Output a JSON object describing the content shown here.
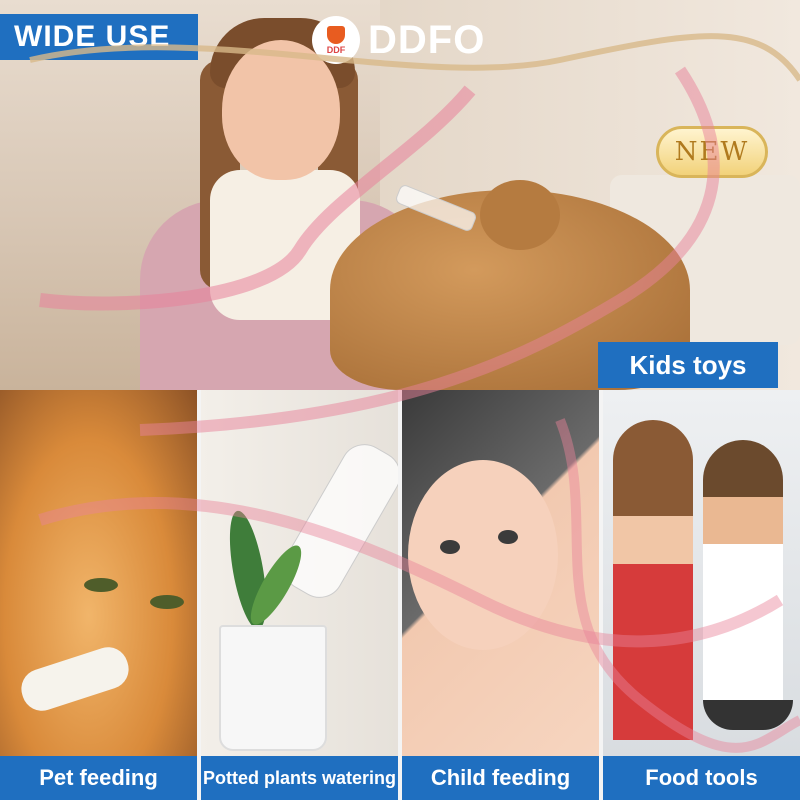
{
  "top_label": "WIDE USE",
  "brand": {
    "logo_text": "DDF",
    "name": "DDFO"
  },
  "badge": "NEW",
  "hero_caption": "Kids toys",
  "panels": [
    {
      "caption": "Pet feeding"
    },
    {
      "caption": "Potted plants watering"
    },
    {
      "caption": "Child feeding"
    },
    {
      "caption": "Food tools"
    }
  ],
  "colors": {
    "caption_bg": "#1f6fc0",
    "ribbon": "#e8829a",
    "badge_gold": "#d9b55a"
  }
}
